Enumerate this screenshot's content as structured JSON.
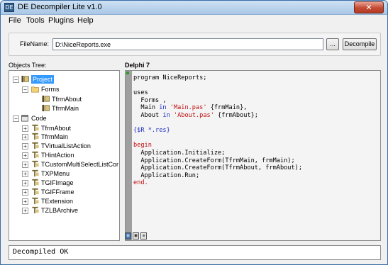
{
  "window": {
    "title": "DE Decompiler Lite v1.0",
    "close_symbol": "✕"
  },
  "menu": [
    {
      "label": "File"
    },
    {
      "label": "Tools"
    },
    {
      "label": "Plugins"
    },
    {
      "label": "Help"
    }
  ],
  "file": {
    "label": "FileName:",
    "value": "D:\\NiceReports.exe",
    "browse_label": "...",
    "decompile_label": "Decompile"
  },
  "tree": {
    "label": "Objects Tree:",
    "project": "Project",
    "forms": "Forms",
    "form_items": [
      "TfrmAbout",
      "TfrmMain"
    ],
    "code": "Code",
    "code_items": [
      "TfrmAbout",
      "TfrmMain",
      "TVirtualListAction",
      "THintAction",
      "TCustomMultiSelectListCor",
      "TXPMenu",
      "TGIFImage",
      "TGIFFrame",
      "TExtension",
      "TZLBArchive"
    ]
  },
  "editor": {
    "language": "Delphi 7",
    "lines": {
      "l1": "program NiceReports;",
      "l3": "uses",
      "l4": "  Forms ,",
      "l5a": "  Main ",
      "in": "in",
      "l5s": "'Main.pas'",
      "l5e": " {frmMain},",
      "l6a": "  About ",
      "l6s": "'About.pas'",
      "l6e": " {frmAbout};",
      "l8": "{$R *.res}",
      "l10": "begin",
      "l11": "  Application.Initialize;",
      "l12": "  Application.CreateForm(TfrmMain, frmMain);",
      "l13": "  Application.CreateForm(TfrmAbout, frmAbout);",
      "l14": "  Application.Run;",
      "l15": "end."
    }
  },
  "status": {
    "text": "Decompiled OK"
  }
}
